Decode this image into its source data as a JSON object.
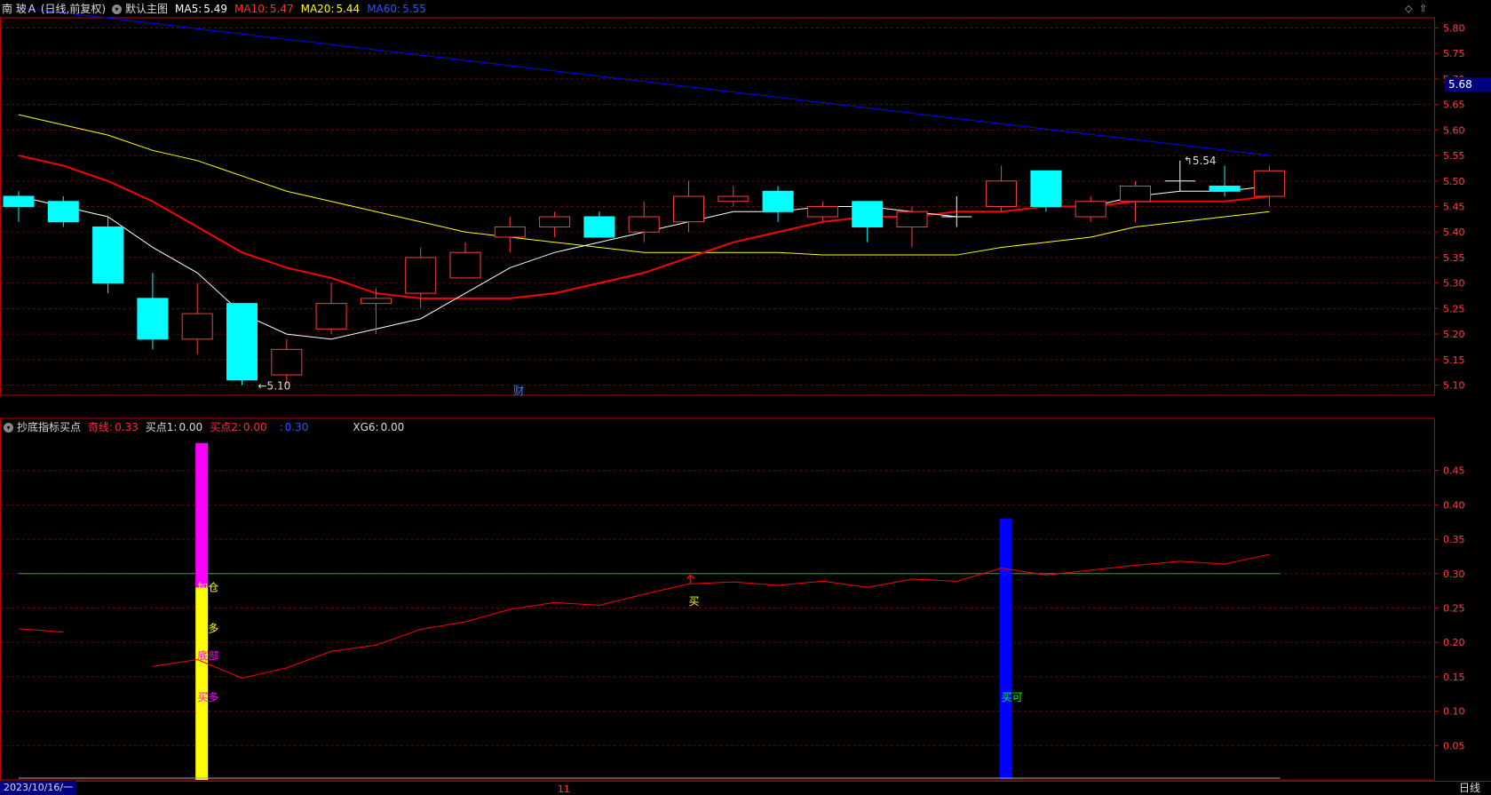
{
  "header": {
    "symbol": "南 玻Ａ",
    "period": "(日线,前复权)",
    "template": "默认主图",
    "ma5_label": "MA5:",
    "ma5_value": "5.49",
    "ma10_label": "MA10:",
    "ma10_value": "5.47",
    "ma20_label": "MA20:",
    "ma20_value": "5.44",
    "ma60_label": "MA60:",
    "ma60_value": "5.55"
  },
  "indicator_header": {
    "name": "抄底指标买点",
    "l1_label": "奇线:",
    "l1_value": "0.33",
    "l2_label": "买点1:",
    "l2_value": "0.00",
    "l3_label": "买点2:",
    "l3_value": "0.00",
    "l4_label": ":",
    "l4_value": "0.30",
    "l5_label": "XG6:",
    "l5_value": "0.00"
  },
  "current_price_label": "5.68",
  "bottom": {
    "date": "2023/10/16/一",
    "month_mark": "11",
    "period": "日线"
  },
  "colors": {
    "up": "#ff3b3b",
    "down": "#00ffff",
    "ma5": "#ffffff",
    "ma10": "#ff0000",
    "ma20": "#ffff00",
    "ma60": "#0000ff",
    "grid": "#8b0000",
    "axis": "#c00000",
    "magenta": "#ff00ff",
    "blue_bar": "#0000ff",
    "green": "#00c000"
  },
  "chart_data": [
    {
      "type": "candlestick",
      "ylim": [
        5.08,
        5.82
      ],
      "yticks": [
        "5.80",
        "5.75",
        "5.70",
        "5.65",
        "5.60",
        "5.55",
        "5.50",
        "5.45",
        "5.40",
        "5.35",
        "5.30",
        "5.25",
        "5.20",
        "5.15",
        "5.10"
      ],
      "candles": [
        {
          "o": 5.47,
          "c": 5.45,
          "h": 5.48,
          "l": 5.42
        },
        {
          "o": 5.46,
          "c": 5.42,
          "h": 5.47,
          "l": 5.41
        },
        {
          "o": 5.41,
          "c": 5.3,
          "h": 5.43,
          "l": 5.28
        },
        {
          "o": 5.27,
          "c": 5.19,
          "h": 5.32,
          "l": 5.17
        },
        {
          "o": 5.19,
          "c": 5.24,
          "h": 5.3,
          "l": 5.16
        },
        {
          "o": 5.26,
          "c": 5.11,
          "h": 5.26,
          "l": 5.1
        },
        {
          "o": 5.12,
          "c": 5.17,
          "h": 5.19,
          "l": 5.1
        },
        {
          "o": 5.21,
          "c": 5.26,
          "h": 5.3,
          "l": 5.2
        },
        {
          "o": 5.26,
          "c": 5.27,
          "h": 5.29,
          "l": 5.2
        },
        {
          "o": 5.28,
          "c": 5.35,
          "h": 5.37,
          "l": 5.25
        },
        {
          "o": 5.31,
          "c": 5.36,
          "h": 5.38,
          "l": 5.31
        },
        {
          "o": 5.39,
          "c": 5.41,
          "h": 5.43,
          "l": 5.36
        },
        {
          "o": 5.41,
          "c": 5.43,
          "h": 5.44,
          "l": 5.39
        },
        {
          "o": 5.43,
          "c": 5.39,
          "h": 5.44,
          "l": 5.39
        },
        {
          "o": 5.4,
          "c": 5.43,
          "h": 5.46,
          "l": 5.38
        },
        {
          "o": 5.42,
          "c": 5.47,
          "h": 5.5,
          "l": 5.4
        },
        {
          "o": 5.46,
          "c": 5.47,
          "h": 5.49,
          "l": 5.45
        },
        {
          "o": 5.48,
          "c": 5.44,
          "h": 5.49,
          "l": 5.42
        },
        {
          "o": 5.43,
          "c": 5.45,
          "h": 5.46,
          "l": 5.42
        },
        {
          "o": 5.46,
          "c": 5.41,
          "h": 5.46,
          "l": 5.38
        },
        {
          "o": 5.41,
          "c": 5.44,
          "h": 5.45,
          "l": 5.37
        },
        {
          "o": 5.43,
          "c": 5.43,
          "h": 5.47,
          "l": 5.41
        },
        {
          "o": 5.45,
          "c": 5.5,
          "h": 5.53,
          "l": 5.44
        },
        {
          "o": 5.52,
          "c": 5.45,
          "h": 5.52,
          "l": 5.44
        },
        {
          "o": 5.43,
          "c": 5.46,
          "h": 5.47,
          "l": 5.42
        },
        {
          "o": 5.46,
          "c": 5.49,
          "h": 5.5,
          "l": 5.42
        },
        {
          "o": 5.5,
          "c": 5.5,
          "h": 5.54,
          "l": 5.48
        },
        {
          "o": 5.49,
          "c": 5.48,
          "h": 5.53,
          "l": 5.47
        },
        {
          "o": 5.47,
          "c": 5.52,
          "h": 5.53,
          "l": 5.45
        }
      ],
      "ma5": [
        5.47,
        5.45,
        5.43,
        5.37,
        5.32,
        5.24,
        5.2,
        5.19,
        5.21,
        5.23,
        5.28,
        5.33,
        5.36,
        5.38,
        5.4,
        5.42,
        5.44,
        5.44,
        5.45,
        5.45,
        5.44,
        5.43,
        null,
        null,
        5.45,
        5.47,
        5.48,
        5.48,
        5.49
      ],
      "ma10": [
        5.55,
        5.53,
        5.5,
        5.46,
        5.41,
        5.36,
        5.33,
        5.31,
        5.28,
        5.27,
        5.27,
        5.27,
        5.28,
        5.3,
        5.32,
        5.35,
        5.38,
        5.4,
        5.42,
        5.43,
        5.43,
        5.44,
        5.44,
        5.45,
        5.45,
        5.46,
        5.46,
        5.46,
        5.47
      ],
      "ma20": [
        5.63,
        5.61,
        5.59,
        5.56,
        5.54,
        5.51,
        5.48,
        5.46,
        5.44,
        5.42,
        5.4,
        5.39,
        5.38,
        5.37,
        5.36,
        5.36,
        5.36,
        5.36,
        5.355,
        5.355,
        5.355,
        5.355,
        5.37,
        5.38,
        5.39,
        5.41,
        5.42,
        5.43,
        5.44
      ],
      "ma60_start": 5.84,
      "ma60_end": 5.55,
      "annotations": [
        {
          "text": "5.10",
          "candle": 5
        },
        {
          "text": "5.54",
          "candle": 26
        },
        {
          "text": "财",
          "candle": 11
        }
      ]
    },
    {
      "type": "line+bar",
      "ylim": [
        0.0,
        0.5
      ],
      "yticks": [
        "0.45",
        "0.40",
        "0.35",
        "0.30",
        "0.25",
        "0.20",
        "0.15",
        "0.10",
        "0.05"
      ],
      "reference_line": 0.3,
      "line_values": [
        0.22,
        0.215,
        null,
        0.165,
        0.175,
        0.148,
        0.163,
        0.187,
        0.196,
        0.219,
        0.23,
        0.248,
        0.258,
        0.254,
        0.27,
        0.285,
        0.288,
        0.283,
        0.289,
        0.28,
        0.292,
        0.289,
        0.308,
        0.298,
        0.305,
        0.312,
        0.318,
        0.314,
        0.328
      ],
      "bars": [
        {
          "candle": 4,
          "bottom": 0.0,
          "split": 0.28,
          "top": 0.49,
          "lower_color": "#ffff00",
          "upper_color": "#ff00ff"
        },
        {
          "candle": 22,
          "bottom": 0.0,
          "top": 0.38,
          "color": "#0000ff"
        }
      ],
      "labels": [
        {
          "text": "加仓",
          "candle": 4,
          "y": 0.28,
          "color": "#ffff00"
        },
        {
          "text": "买多",
          "candle": 4,
          "y": 0.22,
          "color": "#ffff00"
        },
        {
          "text": "底部",
          "candle": 4,
          "y": 0.18,
          "color": "#ff00ff"
        },
        {
          "text": "买多",
          "candle": 4,
          "y": 0.12,
          "color": "#ff00ff"
        },
        {
          "text": "买",
          "candle": 15,
          "y": 0.26,
          "color": "#ffff00"
        },
        {
          "text": "买可",
          "candle": 22,
          "y": 0.12,
          "color": "#00ff00"
        }
      ]
    }
  ]
}
